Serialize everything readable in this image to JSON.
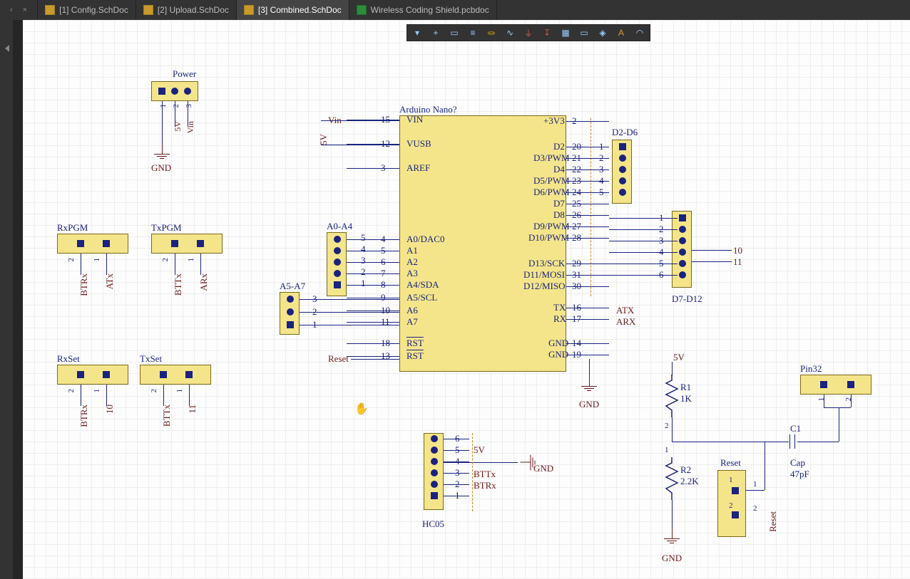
{
  "tabs": [
    {
      "label": "[1] Config.SchDoc",
      "active": false,
      "type": "sch"
    },
    {
      "label": "[2] Upload.SchDoc",
      "active": false,
      "type": "sch"
    },
    {
      "label": "[3] Combined.SchDoc",
      "active": true,
      "type": "sch"
    },
    {
      "label": "Wireless Coding Shield.pcbdoc",
      "active": false,
      "type": "pcb"
    }
  ],
  "activebar": {
    "tools": [
      {
        "name": "filter-icon",
        "glyph": "▾"
      },
      {
        "name": "crosshair-icon",
        "glyph": "+"
      },
      {
        "name": "select-rect-icon",
        "glyph": "▭"
      },
      {
        "name": "align-icon",
        "glyph": "≡"
      },
      {
        "name": "resistor-icon",
        "glyph": "⏛"
      },
      {
        "name": "net-icon",
        "glyph": "∿"
      },
      {
        "name": "ground-icon",
        "glyph": "⏚"
      },
      {
        "name": "power-icon",
        "glyph": "↧"
      },
      {
        "name": "part-icon",
        "glyph": "▦"
      },
      {
        "name": "sheet-icon",
        "glyph": "▭"
      },
      {
        "name": "port-icon",
        "glyph": "◈"
      },
      {
        "name": "text-icon",
        "glyph": "A"
      },
      {
        "name": "arc-icon",
        "glyph": "◠"
      }
    ]
  },
  "labels": {
    "power_title": "Power",
    "power_gnd": "GND",
    "vin": "Vin",
    "fiveV": "5V",
    "ic_title": "Arduino Nano?",
    "rxpgm": "RxPGM",
    "txpgm": "TxPGM",
    "rxset": "RxSet",
    "txset": "TxSet",
    "btrx": "BTRx",
    "atx": "ATx",
    "bttx": "BTTx",
    "arx": "ARx",
    "a0a4": "A0-A4",
    "a5a7": "A5-A7",
    "reset_net": "Reset",
    "d2d6": "D2-D6",
    "d7d12": "D7-D12",
    "atx_right": "ATX",
    "arx_right": "ARX",
    "gnd": "GND",
    "hc05": "HC05",
    "hc05_5v": "5V",
    "hc05_gnd": "GND",
    "hc05_bttx": "BTTx",
    "hc05_btrx": "BTRx",
    "r1": "R1",
    "r1v": "1K",
    "r2": "R2",
    "r2v": "2.2K",
    "c1": "C1",
    "cap_t": "Cap",
    "cap_v": "47pF",
    "right_gnd": "GND",
    "right_5v": "5V",
    "reset_hdr": "Reset",
    "reset_side": "Reset",
    "pin32": "Pin32",
    "ten": "10",
    "eleven": "11"
  },
  "small_hdr_pins": {
    "two_one": [
      "2",
      "1"
    ],
    "one_two_three": [
      "1",
      "2",
      "3"
    ]
  },
  "ic": {
    "left": [
      {
        "n": "15",
        "name": "VIN"
      },
      {
        "n": "12",
        "name": "VUSB"
      },
      {
        "n": "3",
        "name": "AREF"
      },
      {
        "n": "4",
        "name": "A0/DAC0",
        "hp": "5"
      },
      {
        "n": "5",
        "name": "A1",
        "hp": "4"
      },
      {
        "n": "6",
        "name": "A2",
        "hp": "3"
      },
      {
        "n": "7",
        "name": "A3",
        "hp": "2"
      },
      {
        "n": "8",
        "name": "A4/SDA",
        "hp": "1"
      },
      {
        "n": "9",
        "name": "A5/SCL"
      },
      {
        "n": "10",
        "name": "A6"
      },
      {
        "n": "11",
        "name": "A7"
      },
      {
        "n": "18",
        "name": "RST",
        "ov": true
      },
      {
        "n": "13",
        "name": "RST",
        "ov": true
      }
    ],
    "right": [
      {
        "n": "2",
        "name": "+3V3"
      },
      {
        "n": "20",
        "name": "D2"
      },
      {
        "n": "21",
        "name": "D3/PWM"
      },
      {
        "n": "22",
        "name": "D4"
      },
      {
        "n": "23",
        "name": "D5/PWM"
      },
      {
        "n": "24",
        "name": "D6/PWM"
      },
      {
        "n": "25",
        "name": "D7"
      },
      {
        "n": "26",
        "name": "D8"
      },
      {
        "n": "27",
        "name": "D9/PWM"
      },
      {
        "n": "28",
        "name": "D10/PWM"
      },
      {
        "n": "29",
        "name": "D13/SCK"
      },
      {
        "n": "31",
        "name": "D11/MOSI"
      },
      {
        "n": "30",
        "name": "D12/MISO"
      },
      {
        "n": "16",
        "name": "TX"
      },
      {
        "n": "17",
        "name": "RX"
      },
      {
        "n": "14",
        "name": "GND"
      },
      {
        "n": "19",
        "name": "GND"
      }
    ]
  },
  "hc05_pins": [
    "6",
    "5",
    "4",
    "3",
    "2",
    "1"
  ],
  "a5a7_pins": [
    "3",
    "2",
    "1"
  ],
  "d2d6_pins": [
    "1",
    "2",
    "3",
    "4",
    "5"
  ],
  "d7d12_pins": [
    "1",
    "2",
    "3",
    "4",
    "5",
    "6"
  ],
  "reset_pins": [
    "1",
    "2"
  ],
  "pin32_pins": [
    "1",
    "2"
  ]
}
